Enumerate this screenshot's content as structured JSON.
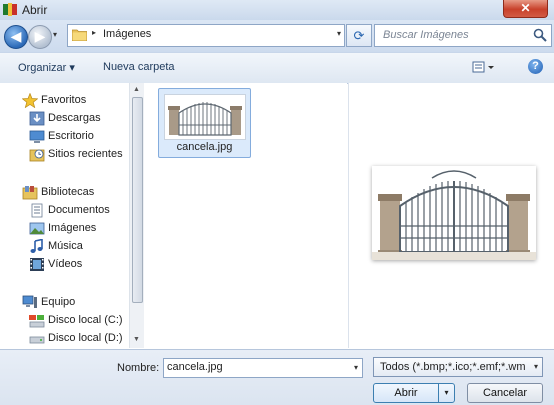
{
  "window": {
    "title": "Abrir",
    "close_glyph": "✕"
  },
  "address": {
    "folder": "Imágenes",
    "crumb_arrow": "▸",
    "dropdown": "▾"
  },
  "nav": {
    "back_glyph": "◀",
    "forward_glyph": "▶",
    "recent_glyph": "▾",
    "refresh_glyph": "⟳"
  },
  "search": {
    "placeholder": "Buscar Imágenes"
  },
  "toolbar": {
    "organize": "Organizar ▾",
    "new_folder": "Nueva carpeta",
    "help": "?"
  },
  "sidebar": {
    "favorites": {
      "label": "Favoritos",
      "icon": "star-icon"
    },
    "favorites_items": [
      {
        "label": "Descargas",
        "icon": "downloads-icon"
      },
      {
        "label": "Escritorio",
        "icon": "desktop-icon"
      },
      {
        "label": "Sitios recientes",
        "icon": "recent-places-icon"
      }
    ],
    "libraries": {
      "label": "Bibliotecas",
      "icon": "libraries-icon"
    },
    "libraries_items": [
      {
        "label": "Documentos",
        "icon": "documents-icon"
      },
      {
        "label": "Imágenes",
        "icon": "pictures-icon"
      },
      {
        "label": "Música",
        "icon": "music-icon"
      },
      {
        "label": "Vídeos",
        "icon": "videos-icon"
      }
    ],
    "computer": {
      "label": "Equipo",
      "icon": "computer-icon"
    },
    "computer_items": [
      {
        "label": "Disco local (C:)",
        "icon": "drive-icon"
      },
      {
        "label": "Disco local (D:)",
        "icon": "drive-icon"
      }
    ]
  },
  "files": [
    {
      "name": "cancela.jpg",
      "selected": true
    }
  ],
  "bottom": {
    "name_label": "Nombre:",
    "name_value": "cancela.jpg",
    "filter": "Todos (*.bmp;*.ico;*.emf;*.wmf",
    "open": "Abrir",
    "cancel": "Cancelar",
    "dropdown": "▾"
  },
  "colors": {
    "accent": "#3c7fb1",
    "selection": "#dbeafb"
  }
}
